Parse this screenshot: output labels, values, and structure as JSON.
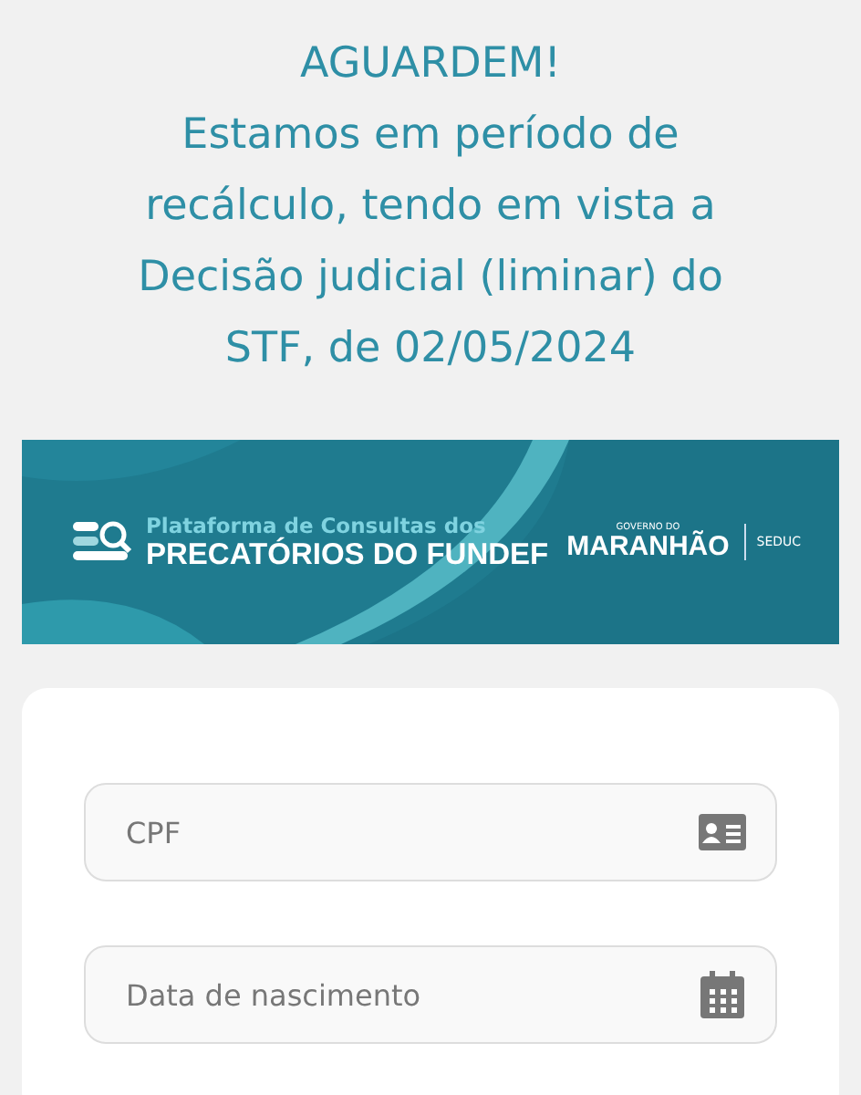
{
  "notice": {
    "title": "AGUARDEM!",
    "message": "Estamos em período de recálculo, tendo em vista a Decisão judicial (liminar) do STF, de 02/05/2024"
  },
  "banner": {
    "subtitle": "Plataforma de Consultas dos",
    "title": "PRECATÓRIOS DO FUNDEF",
    "gov_label": "GOVERNO DO",
    "gov_name": "MARANHÃO",
    "department": "SEDUC"
  },
  "form": {
    "fields": [
      {
        "placeholder": "CPF",
        "kind": "id"
      },
      {
        "placeholder": "Data de nascimento",
        "kind": "date"
      }
    ]
  }
}
